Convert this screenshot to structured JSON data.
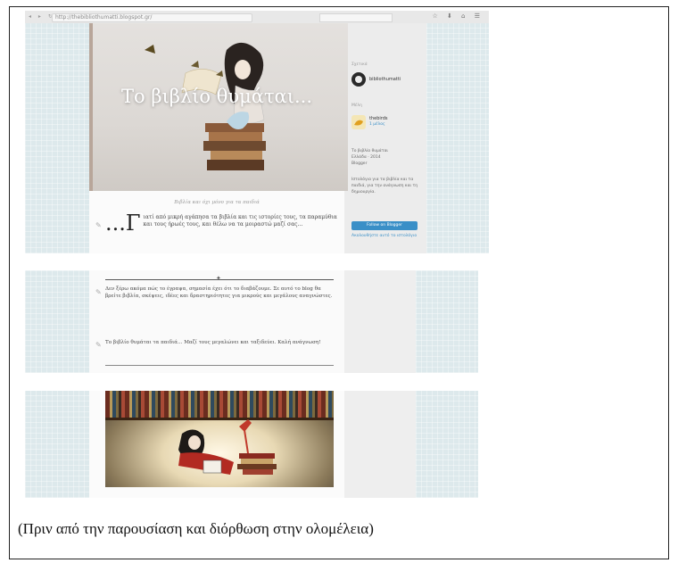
{
  "browser": {
    "url": "http://thebibliothumatti.blogspot.gr/",
    "search_placeholder": "",
    "tool_icons": "☆ ⬇ ⌂ ☰"
  },
  "blog": {
    "title": "Το βιβλίο θυμάται...",
    "tagline": "Βιβλία και όχι μόνο για τα παιδιά",
    "quote_dropcap": "...Γ",
    "quote_text": "ιατί από μικρή αγάπησα τα βιβλία και τις ιστορίες τους, τα παραμύθια και τους ήρωές τους, και θέλω να τα μοιραστώ μαζί σας...",
    "paragraph1": "Δεν ξέρω ακόμα πώς το έγραψα, σημασία έχει ότι το διαβάζουμε. Σε αυτό το blog θα βρείτε βιβλία, σκέψεις, ιδέες και δραστηριότητες για μικρούς και μεγάλους αναγνώστες.",
    "paragraph2": "Το βιβλίο θυμάται τα παιδιά... Μαζί τους μεγαλώνει και ταξιδεύει. Καλή ανάγνωση!"
  },
  "sidebar": {
    "label_about": "Σχετικά",
    "username": "bibliothumatti",
    "label_followers": "Μέλη",
    "follower_name": "thebirds",
    "follower_sub": "1 μέλος",
    "info_lines": [
      "Το βιβλίο θυμάται",
      "Ελλάδα · 2014",
      "Blogger"
    ],
    "desc": "Ιστολόγιο για τα βιβλία και τα παιδιά, για την ανάγνωση και τη δημιουργία.",
    "follow_label": "Follow on Blogger",
    "follow_note": "Ακολουθήστε αυτό το ιστολόγιο"
  },
  "caption": "(Πριν από την παρουσίαση και διόρθωση στην ολομέλεια)"
}
